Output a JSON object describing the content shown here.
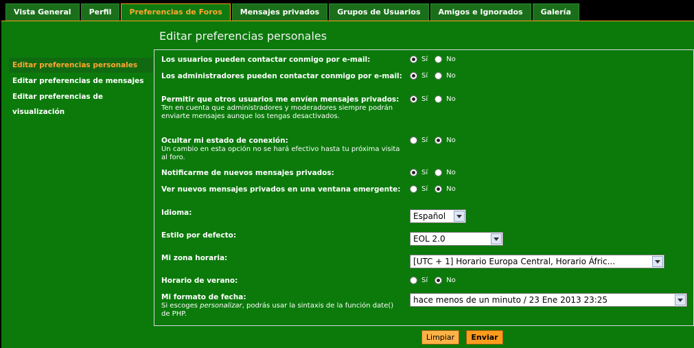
{
  "tabs": [
    {
      "label": "Vista General",
      "active": false
    },
    {
      "label": "Perfil",
      "active": false
    },
    {
      "label": "Preferencias de Foros",
      "active": true
    },
    {
      "label": "Mensajes privados",
      "active": false
    },
    {
      "label": "Grupos de Usuarios",
      "active": false
    },
    {
      "label": "Amigos e Ignorados",
      "active": false
    },
    {
      "label": "Galería",
      "active": false
    }
  ],
  "page_title": "Editar preferencias personales",
  "nav": [
    {
      "label": "Editar preferencias personales",
      "active": true
    },
    {
      "label": "Editar preferencias de mensajes",
      "active": false
    },
    {
      "label": "Editar preferencias de visualización",
      "active": false
    }
  ],
  "options": {
    "yes": "Sí",
    "no": "No"
  },
  "form": {
    "contact_email": {
      "label": "Los usuarios pueden contactar conmigo por e-mail:",
      "value": "yes"
    },
    "admin_email": {
      "label": "Los administradores pueden contactar conmigo por e-mail:",
      "value": "yes"
    },
    "allow_pm": {
      "label": "Permitir que otros usuarios me envíen mensajes privados:",
      "desc": "Ten en cuenta que administradores y moderadores siempre podrán enviarte mensajes aunque los tengas desactivados.",
      "value": "yes"
    },
    "hide_online": {
      "label": "Ocultar mi estado de conexión:",
      "desc": "Un cambio en esta opción no se hará efectivo hasta tu próxima visita al foro.",
      "value": "no"
    },
    "notify_pm": {
      "label": "Notificarme de nuevos mensajes privados:",
      "value": "yes"
    },
    "popup_pm": {
      "label": "Ver nuevos mensajes privados en una ventana emergente:",
      "value": "no"
    },
    "language": {
      "label": "Idioma:",
      "value": "Español"
    },
    "style": {
      "label": "Estilo por defecto:",
      "value": "EOL 2.0"
    },
    "timezone": {
      "label": "Mi zona horaria:",
      "value": "[UTC + 1] Horario Europa Central, Horario Áfric..."
    },
    "dst": {
      "label": "Horario de verano:",
      "value": "no"
    },
    "date_format": {
      "label": "Mi formato de fecha:",
      "desc_before": "Si escoges ",
      "desc_em": "personalizar",
      "desc_after": ", podrás usar la sintaxis de la función date() de PHP.",
      "value": "hace menos de un minuto / 23 Ene 2013 23:25"
    }
  },
  "buttons": {
    "reset": "Limpiar",
    "submit": "Enviar"
  },
  "colors": {
    "accent": "#ff9c1e",
    "panel": "#0b7a0b",
    "tab": "#1b6f1b"
  }
}
